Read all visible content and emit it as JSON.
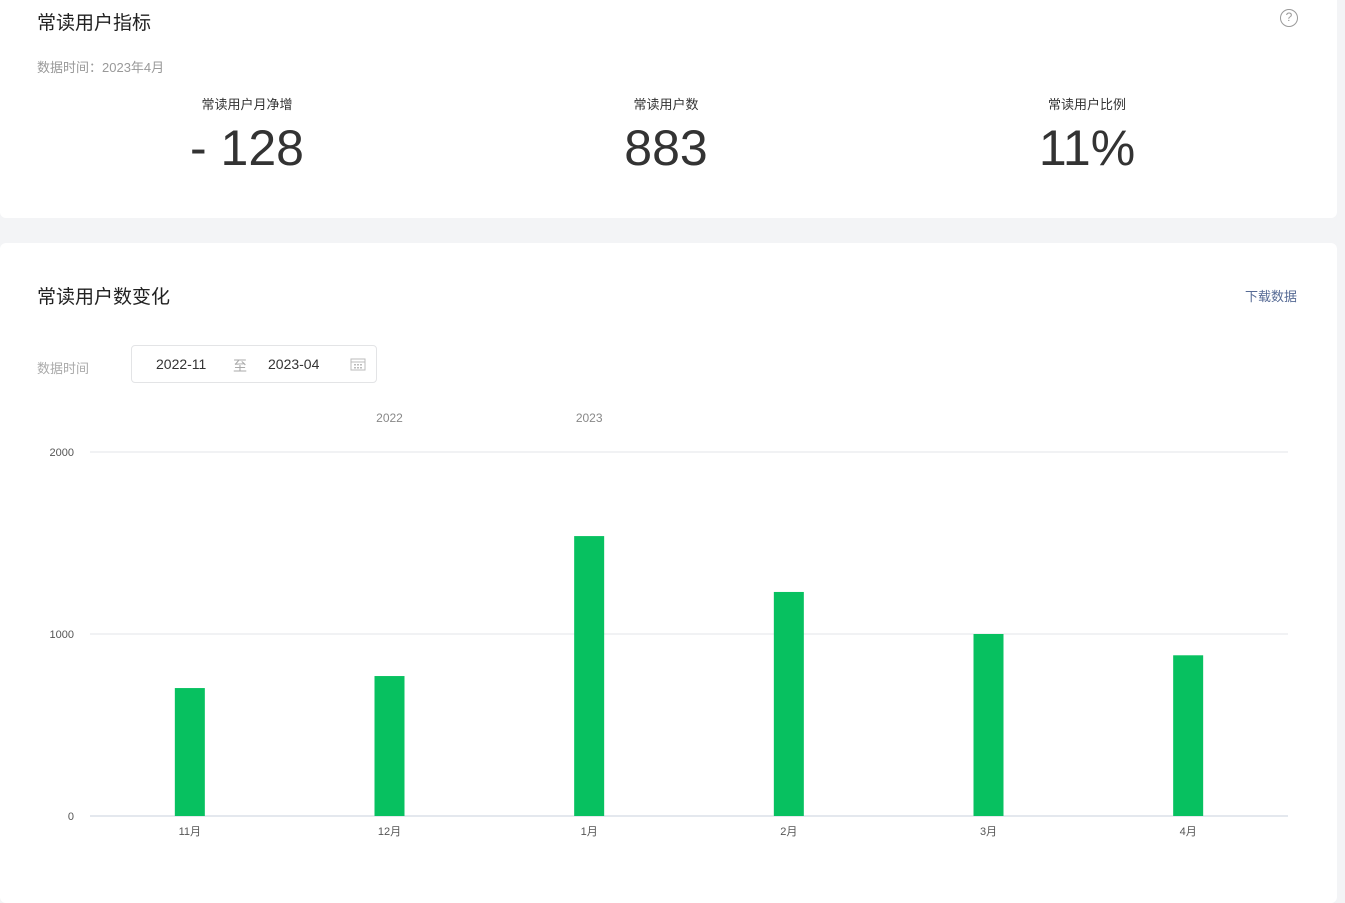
{
  "metrics_card": {
    "title": "常读用户指标",
    "help_icon": "?",
    "data_time": "数据时间：2023年4月",
    "metrics": [
      {
        "label": "常读用户月净增",
        "value": "- 128"
      },
      {
        "label": "常读用户数",
        "value": "883"
      },
      {
        "label": "常读用户比例",
        "value": "11%"
      }
    ]
  },
  "chart_card": {
    "title": "常读用户数变化",
    "download": "下载数据",
    "filter_label": "数据时间",
    "range_start": "2022-11",
    "range_sep": "至",
    "range_end": "2023-04"
  },
  "chart_data": {
    "type": "bar",
    "categories": [
      "11月",
      "12月",
      "1月",
      "2月",
      "3月",
      "4月"
    ],
    "values": [
      703,
      769,
      1538,
      1231,
      1000,
      883
    ],
    "year_labels": [
      {
        "label": "2022",
        "category_index": 1
      },
      {
        "label": "2023",
        "category_index": 2
      }
    ],
    "yticks": [
      0,
      1000,
      2000
    ],
    "ylim": [
      0,
      2000
    ],
    "color": "#07c160",
    "grid": true
  }
}
